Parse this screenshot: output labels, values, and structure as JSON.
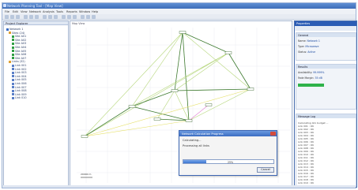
{
  "window": {
    "title": "Network Planning Tool - [Map View]"
  },
  "menu": [
    "File",
    "Edit",
    "View",
    "Network",
    "Analysis",
    "Tools",
    "Reports",
    "Window",
    "Help"
  ],
  "left_panel": {
    "title": "Project Explorer",
    "items": [
      "Network 1",
      "Sites (24)",
      "Site A01",
      "Site A02",
      "Site A03",
      "Site A04",
      "Site A05",
      "Site A06",
      "Site A07",
      "Links (32)",
      "Link 001",
      "Link 002",
      "Link 003",
      "Link 004",
      "Link 005",
      "Link 006",
      "Link 007",
      "Link 008",
      "Link 009",
      "Link 010"
    ]
  },
  "map": {
    "tab": "Map View",
    "scale_label": "20000 m"
  },
  "right_panel": {
    "title": "Properties",
    "general_header": "General",
    "rows": [
      {
        "k": "Name",
        "v": "Network 1"
      },
      {
        "k": "Type",
        "v": "Microwave"
      },
      {
        "k": "Status",
        "v": "Active"
      }
    ],
    "results_header": "Results",
    "result_rows": [
      {
        "k": "Availability",
        "v": "99.999%"
      },
      {
        "k": "Fade Margin",
        "v": "35 dB"
      }
    ],
    "progress_fraction": 0.45,
    "log_header": "Message Log",
    "log_lines": [
      "Calculating link budget ...",
      "Link 001 : OK",
      "Link 002 : OK",
      "Link 003 : OK",
      "Link 004 : OK",
      "Link 005 : OK",
      "Link 006 : OK",
      "Link 007 : OK",
      "Link 008 : OK",
      "Link 009 : OK",
      "Link 010 : OK",
      "Link 011 : OK",
      "Link 012 : OK",
      "Link 013 : OK",
      "Link 014 : OK",
      "Link 015 : OK",
      "Link 016 : OK",
      "Link 017 : OK",
      "Link 018 : OK",
      "Link 019 : OK",
      "Link 020 : OK"
    ]
  },
  "dialog": {
    "title": "Network Calculation Progress",
    "body": "Calculating...",
    "sub": "Processing all links",
    "progress_fraction": 0.25,
    "progress_text": "25%",
    "cancel_label": "Cancel"
  },
  "colors": {
    "link_dark": "#3d7a2e",
    "link_light": "#b5d67a",
    "link_yellow": "#e6e06a",
    "link_pink": "#e07ad0",
    "node_fill": "#ffffff",
    "node_stroke": "#2e5e22"
  }
}
